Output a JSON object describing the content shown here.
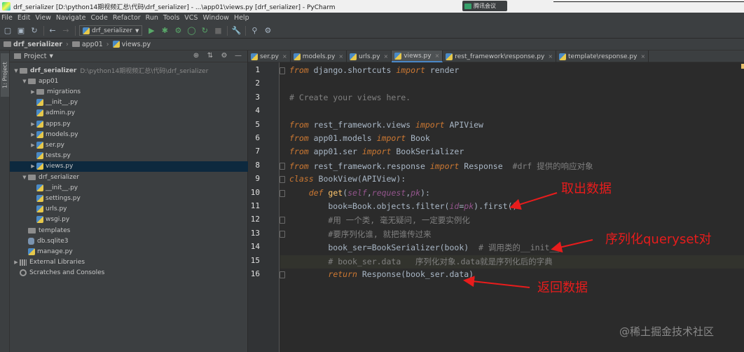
{
  "window": {
    "title": "drf_serializer [D:\\python14期视频汇总\\代码\\drf_serializer] - ...\\app01\\views.py [drf_serializer] - PyCharm",
    "meeting_label": "腾讯会议"
  },
  "menu": [
    "File",
    "Edit",
    "View",
    "Navigate",
    "Code",
    "Refactor",
    "Run",
    "Tools",
    "VCS",
    "Window",
    "Help"
  ],
  "toolbar": {
    "run_config": "drf_serializer"
  },
  "breadcrumb": {
    "project": "drf_serializer",
    "folder": "app01",
    "file": "views.py"
  },
  "side_tab": "1: Project",
  "project_panel": {
    "title": "Project",
    "tree": [
      {
        "label": "drf_serializer",
        "path": "D:\\python14期视频汇总\\代码\\drf_serializer",
        "indent": 0,
        "toggle": "open",
        "icon": "folder"
      },
      {
        "label": "app01",
        "indent": 1,
        "toggle": "open",
        "icon": "folder"
      },
      {
        "label": "migrations",
        "indent": 2,
        "toggle": "closed",
        "icon": "folder"
      },
      {
        "label": "__init__.py",
        "indent": 2,
        "toggle": "",
        "icon": "py"
      },
      {
        "label": "admin.py",
        "indent": 2,
        "toggle": "",
        "icon": "py"
      },
      {
        "label": "apps.py",
        "indent": 2,
        "toggle": "closed",
        "icon": "py"
      },
      {
        "label": "models.py",
        "indent": 2,
        "toggle": "closed",
        "icon": "py"
      },
      {
        "label": "ser.py",
        "indent": 2,
        "toggle": "closed",
        "icon": "py"
      },
      {
        "label": "tests.py",
        "indent": 2,
        "toggle": "",
        "icon": "py"
      },
      {
        "label": "views.py",
        "indent": 2,
        "toggle": "closed",
        "icon": "py",
        "selected": true
      },
      {
        "label": "drf_serializer",
        "indent": 1,
        "toggle": "open",
        "icon": "folder"
      },
      {
        "label": "__init__.py",
        "indent": 2,
        "toggle": "",
        "icon": "py"
      },
      {
        "label": "settings.py",
        "indent": 2,
        "toggle": "",
        "icon": "py"
      },
      {
        "label": "urls.py",
        "indent": 2,
        "toggle": "",
        "icon": "py"
      },
      {
        "label": "wsgi.py",
        "indent": 2,
        "toggle": "",
        "icon": "py"
      },
      {
        "label": "templates",
        "indent": 1,
        "toggle": "",
        "icon": "folder"
      },
      {
        "label": "db.sqlite3",
        "indent": 1,
        "toggle": "",
        "icon": "db"
      },
      {
        "label": "manage.py",
        "indent": 1,
        "toggle": "",
        "icon": "py"
      },
      {
        "label": "External Libraries",
        "indent": 0,
        "toggle": "closed",
        "icon": "lib"
      },
      {
        "label": "Scratches and Consoles",
        "indent": 0,
        "toggle": "",
        "icon": "scratch"
      }
    ]
  },
  "tabs": [
    {
      "label": "ser.py"
    },
    {
      "label": "models.py"
    },
    {
      "label": "urls.py"
    },
    {
      "label": "views.py",
      "active": true
    },
    {
      "label": "rest_framework\\response.py"
    },
    {
      "label": "template\\response.py"
    }
  ],
  "editor": {
    "line_numbers": [
      "1",
      "2",
      "3",
      "4",
      "5",
      "6",
      "7",
      "8",
      "9",
      "10",
      "11",
      "12",
      "13",
      "14",
      "15",
      "16"
    ],
    "highlighted_line": 15,
    "lines": [
      [
        [
          "kw",
          "from "
        ],
        [
          "nm",
          "django.shortcuts "
        ],
        [
          "kw",
          "import "
        ],
        [
          "nm",
          "render"
        ]
      ],
      [],
      [
        [
          "cm",
          "# Create your views here."
        ]
      ],
      [],
      [
        [
          "kw",
          "from "
        ],
        [
          "nm",
          "rest_framework.views "
        ],
        [
          "kw",
          "import "
        ],
        [
          "nm",
          "APIView"
        ]
      ],
      [
        [
          "kw",
          "from "
        ],
        [
          "nm",
          "app01.models "
        ],
        [
          "kw",
          "import "
        ],
        [
          "nm",
          "Book"
        ]
      ],
      [
        [
          "kw",
          "from "
        ],
        [
          "nm",
          "app01.ser "
        ],
        [
          "kw",
          "import "
        ],
        [
          "nm",
          "BookSerializer"
        ]
      ],
      [
        [
          "kw",
          "from "
        ],
        [
          "nm",
          "rest_framework.response "
        ],
        [
          "kw",
          "import "
        ],
        [
          "nm",
          "Response  "
        ],
        [
          "cm",
          "#drf 提供的响应对象"
        ]
      ],
      [
        [
          "kw",
          "class "
        ],
        [
          "nm",
          "BookView(APIView):"
        ]
      ],
      [
        [
          "nm",
          "    "
        ],
        [
          "kw",
          "def "
        ],
        [
          "fn",
          "get"
        ],
        [
          "nm",
          "("
        ],
        [
          "pm",
          "self"
        ],
        [
          "nm",
          ","
        ],
        [
          "pm",
          "request"
        ],
        [
          "nm",
          ","
        ],
        [
          "pm",
          "pk"
        ],
        [
          "nm",
          "):"
        ]
      ],
      [
        [
          "nm",
          "        book=Book.objects.filter("
        ],
        [
          "pm",
          "id"
        ],
        [
          "nm",
          "="
        ],
        [
          "pm",
          "pk"
        ],
        [
          "nm",
          ").first()"
        ]
      ],
      [
        [
          "nm",
          "        "
        ],
        [
          "cm",
          "#用 一个类, 毫无疑问, 一定要实例化"
        ]
      ],
      [
        [
          "nm",
          "        "
        ],
        [
          "cm",
          "#要序列化谁, 就把谁传过来"
        ]
      ],
      [
        [
          "nm",
          "        book_ser=BookSerializer(book)  "
        ],
        [
          "cm",
          "# 调用类的__init__"
        ]
      ],
      [
        [
          "nm",
          "        "
        ],
        [
          "cm",
          "# book_ser.data   序列化对象.data就是序列化后的字典"
        ]
      ],
      [
        [
          "nm",
          "        "
        ],
        [
          "kw",
          "return "
        ],
        [
          "nm",
          "Response(book_ser.data)"
        ]
      ]
    ]
  },
  "annotations": {
    "a1": "取出数据",
    "a2": "序列化queryset对",
    "a3": "返回数据",
    "color": "#e81c1c"
  },
  "watermark": "@稀土掘金技术社区"
}
